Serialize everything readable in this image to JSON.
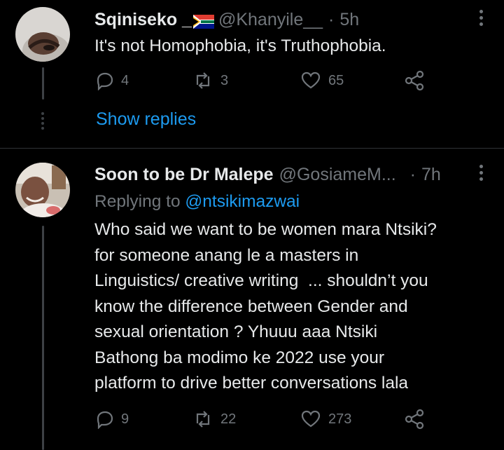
{
  "tweet1": {
    "name": "Sqiniseko _",
    "flag": "south-africa-flag",
    "handle": "@Khanyile__",
    "dot": "·",
    "time": "5h",
    "text": "It's not Homophobia, it's Truthophobia.",
    "reply_count": "4",
    "retweet_count": "3",
    "like_count": "65"
  },
  "show_replies": "Show replies",
  "tweet2": {
    "name": "Soon to be Dr Malepe",
    "handle": "@GosiameM...",
    "dot": "·",
    "time": "7h",
    "replying_label": "Replying to",
    "replying_mention": "@ntsikimazwai",
    "lines": [
      "Who said we want to be women mara Ntsiki?",
      "for someone anang le a masters in",
      "Linguistics/ creative writing  ... shouldn’t you",
      "know the difference between Gender and",
      "sexual orientation ? Yhuuu aaa Ntsiki",
      "Bathong ba modimo ke 2022 use your",
      "platform to drive better conversations lala"
    ],
    "reply_count": "9",
    "retweet_count": "22",
    "like_count": "273"
  },
  "colors": {
    "background": "#000000",
    "text": "#e7e9ea",
    "secondary": "#71767b",
    "link": "#1d9bf0"
  }
}
